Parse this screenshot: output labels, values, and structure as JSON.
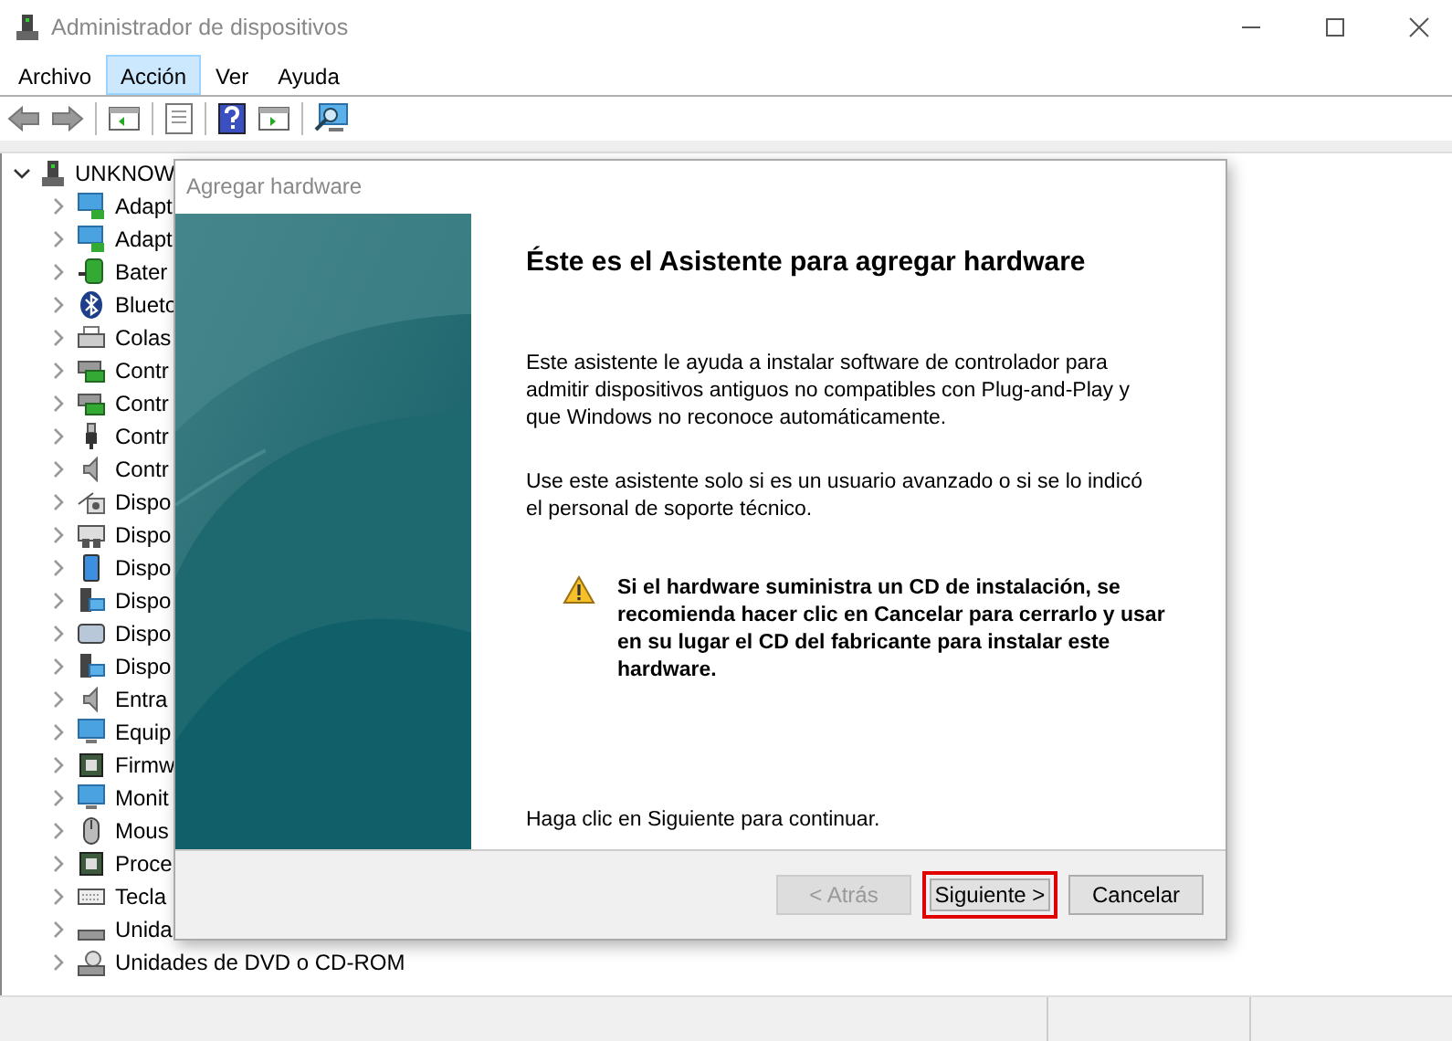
{
  "window": {
    "title": "Administrador de dispositivos"
  },
  "menu": [
    {
      "label": "Archivo",
      "selected": false
    },
    {
      "label": "Acción",
      "selected": true
    },
    {
      "label": "Ver",
      "selected": false
    },
    {
      "label": "Ayuda",
      "selected": false
    }
  ],
  "tree": {
    "label": "UNKNOW",
    "expanded": true,
    "children": [
      {
        "label": "Adapt",
        "expanded": false
      },
      {
        "label": "Adapt",
        "expanded": false
      },
      {
        "label": "Bater",
        "expanded": false
      },
      {
        "label": "Blueto",
        "expanded": false
      },
      {
        "label": "Colas",
        "expanded": false
      },
      {
        "label": "Contr",
        "expanded": false
      },
      {
        "label": "Contr",
        "expanded": false
      },
      {
        "label": "Contr",
        "expanded": false
      },
      {
        "label": "Contr",
        "expanded": false
      },
      {
        "label": "Dispo",
        "expanded": false
      },
      {
        "label": "Dispo",
        "expanded": false
      },
      {
        "label": "Dispo",
        "expanded": false
      },
      {
        "label": "Dispo",
        "expanded": false
      },
      {
        "label": "Dispo",
        "expanded": false
      },
      {
        "label": "Dispo",
        "expanded": false
      },
      {
        "label": "Entra",
        "expanded": false
      },
      {
        "label": "Equip",
        "expanded": false
      },
      {
        "label": "Firmw",
        "expanded": false
      },
      {
        "label": "Monit",
        "expanded": false
      },
      {
        "label": "Mous",
        "expanded": false
      },
      {
        "label": "Proce",
        "expanded": false
      },
      {
        "label": "Tecla",
        "expanded": false
      },
      {
        "label": "Unida",
        "expanded": false
      },
      {
        "label": "Unidades de DVD o CD-ROM",
        "expanded": false
      }
    ]
  },
  "dialog": {
    "title": "Agregar hardware",
    "heading": "Éste es el Asistente para agregar hardware",
    "paragraphs": [
      "Este asistente le ayuda a instalar software de controlador para admitir dispositivos antiguos no compatibles con Plug-and-Play y que Windows no reconoce automáticamente.",
      "Use este asistente solo si es un usuario avanzado o si se lo indicó el personal de soporte técnico."
    ],
    "warning": "Si el hardware suministra un CD de instalación, se recomienda hacer clic en Cancelar para cerrarlo y usar en su lugar el CD del fabricante para instalar este hardware.",
    "footer_note": "Haga clic en Siguiente para continuar.",
    "buttons": [
      {
        "label": "< Atrás",
        "disabled": true,
        "highlighted": false
      },
      {
        "label": "Siguiente >",
        "disabled": false,
        "highlighted": true
      },
      {
        "label": "Cancelar",
        "disabled": false,
        "highlighted": false
      }
    ]
  }
}
